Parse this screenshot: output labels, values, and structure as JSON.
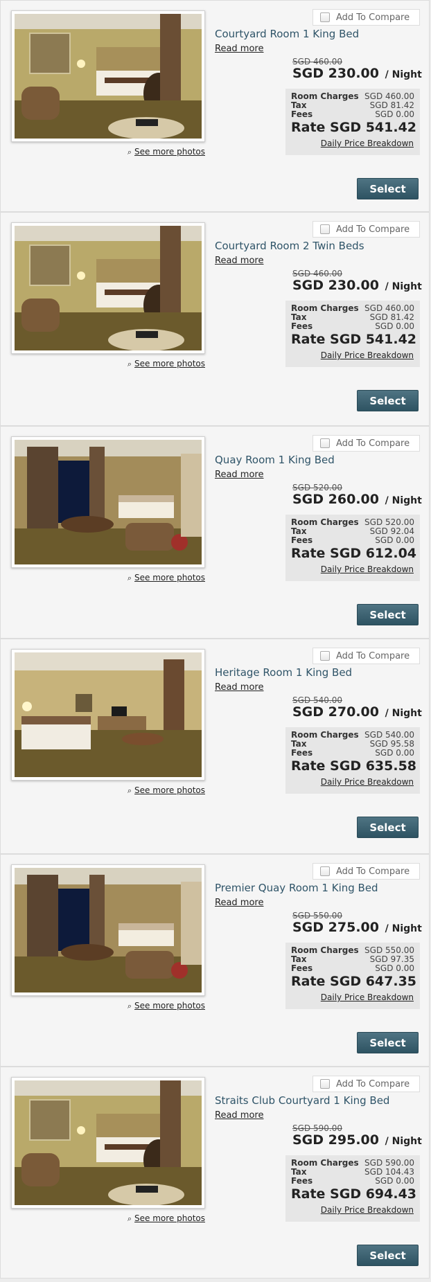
{
  "labels": {
    "compare": "Add To Compare",
    "read_more": "Read more",
    "see_more": "See more photos",
    "per_night": "/ Night",
    "room_charges": "Room Charges",
    "tax": "Tax",
    "fees": "Fees",
    "breakdown": "Daily Price Breakdown",
    "select": "Select"
  },
  "icons": {
    "see_more": "magnifier-icon",
    "compare": "checkbox-icon"
  },
  "colors": {
    "room_name": "#2f5468",
    "select_button": "#3d6270"
  },
  "rooms": [
    {
      "name": "Courtyard Room 1 King Bed",
      "photo": "courtyard-room",
      "original_price": "SGD 460.00",
      "nightly_price": "SGD 230.00",
      "room_charges": "SGD 460.00",
      "tax": "SGD 81.42",
      "fees": "SGD 0.00",
      "rate": "Rate SGD 541.42"
    },
    {
      "name": "Courtyard Room 2 Twin Beds",
      "photo": "courtyard-room",
      "original_price": "SGD 460.00",
      "nightly_price": "SGD 230.00",
      "room_charges": "SGD 460.00",
      "tax": "SGD 81.42",
      "fees": "SGD 0.00",
      "rate": "Rate SGD 541.42"
    },
    {
      "name": "Quay Room 1 King Bed",
      "photo": "quay-room",
      "original_price": "SGD 520.00",
      "nightly_price": "SGD 260.00",
      "room_charges": "SGD 520.00",
      "tax": "SGD 92.04",
      "fees": "SGD 0.00",
      "rate": "Rate SGD 612.04"
    },
    {
      "name": "Heritage Room 1 King Bed",
      "photo": "heritage-room",
      "original_price": "SGD 540.00",
      "nightly_price": "SGD 270.00",
      "room_charges": "SGD 540.00",
      "tax": "SGD 95.58",
      "fees": "SGD 0.00",
      "rate": "Rate SGD 635.58"
    },
    {
      "name": "Premier Quay Room 1 King Bed",
      "photo": "quay-room",
      "original_price": "SGD 550.00",
      "nightly_price": "SGD 275.00",
      "room_charges": "SGD 550.00",
      "tax": "SGD 97.35",
      "fees": "SGD 0.00",
      "rate": "Rate SGD 647.35"
    },
    {
      "name": "Straits Club Courtyard 1 King Bed",
      "photo": "courtyard-room",
      "original_price": "SGD 590.00",
      "nightly_price": "SGD 295.00",
      "room_charges": "SGD 590.00",
      "tax": "SGD 104.43",
      "fees": "SGD 0.00",
      "rate": "Rate SGD 694.43"
    }
  ]
}
